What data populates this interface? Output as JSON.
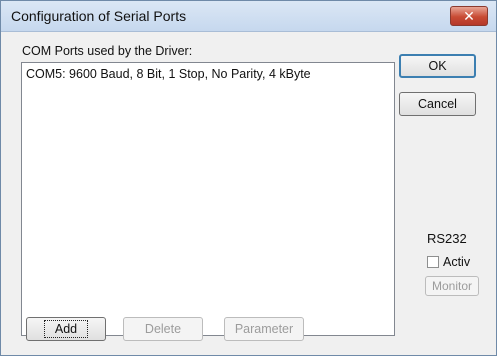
{
  "window": {
    "title": "Configuration of Serial Ports",
    "close_glyph": "✕"
  },
  "list": {
    "label": "COM Ports used by the Driver:",
    "items": [
      "COM5: 9600 Baud, 8 Bit, 1 Stop, No Parity, 4 kByte"
    ]
  },
  "buttons": {
    "ok": "OK",
    "cancel": "Cancel",
    "add": "Add",
    "delete": "Delete",
    "parameter": "Parameter",
    "monitor": "Monitor"
  },
  "rs232": {
    "label": "RS232",
    "activ_label": "Activ",
    "activ_checked": false
  },
  "colors": {
    "title_bg": "#c6d8ee",
    "close_red": "#c84b34",
    "default_border": "#3c7fb1"
  }
}
